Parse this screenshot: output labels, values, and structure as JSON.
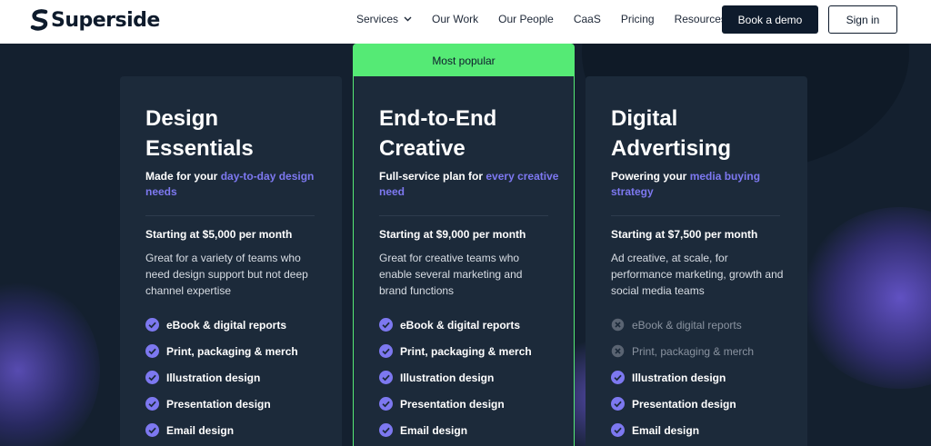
{
  "brand": {
    "name": "Superside"
  },
  "nav": {
    "items": [
      "Services",
      "Our Work",
      "Our People",
      "CaaS",
      "Pricing",
      "Resources"
    ],
    "book_demo": "Book a demo",
    "sign_in": "Sign in"
  },
  "colors": {
    "accent_green": "#55ea75",
    "accent_purple": "#7d78f0",
    "navy": "#0e1b2c",
    "card_bg": "#1c2a3a"
  },
  "plans": [
    {
      "title_l1": "Design",
      "title_l2": "Essentials",
      "sub_pre": "Made for your ",
      "sub_hl": "day-to-day design needs",
      "price": "Starting at $5,000 per month",
      "desc": "Great for a variety of teams who need design support but not deep channel expertise",
      "features": [
        "eBook & digital reports",
        "Print, packaging & merch",
        "Illustration design",
        "Presentation design",
        "Email design"
      ]
    },
    {
      "badge": "Most popular",
      "title_l1": "End-to-End",
      "title_l2": "Creative",
      "sub_pre": "Full-service plan for ",
      "sub_hl": "every creative need",
      "price": "Starting at $9,000 per month",
      "desc": "Great for creative teams who enable several marketing and brand functions",
      "features": [
        "eBook & digital reports",
        "Print, packaging & merch",
        "Illustration design",
        "Presentation design",
        "Email design"
      ]
    },
    {
      "title_l1": "Digital",
      "title_l2": "Advertising",
      "sub_pre": "Powering your ",
      "sub_hl": "media buying strategy",
      "price": "Starting at $7,500 per month",
      "desc": "Ad creative, at scale, for performance marketing, growth and social media teams",
      "features": [
        "eBook & digital reports",
        "Print, packaging & merch",
        "Illustration design",
        "Presentation design",
        "Email design"
      ]
    }
  ]
}
